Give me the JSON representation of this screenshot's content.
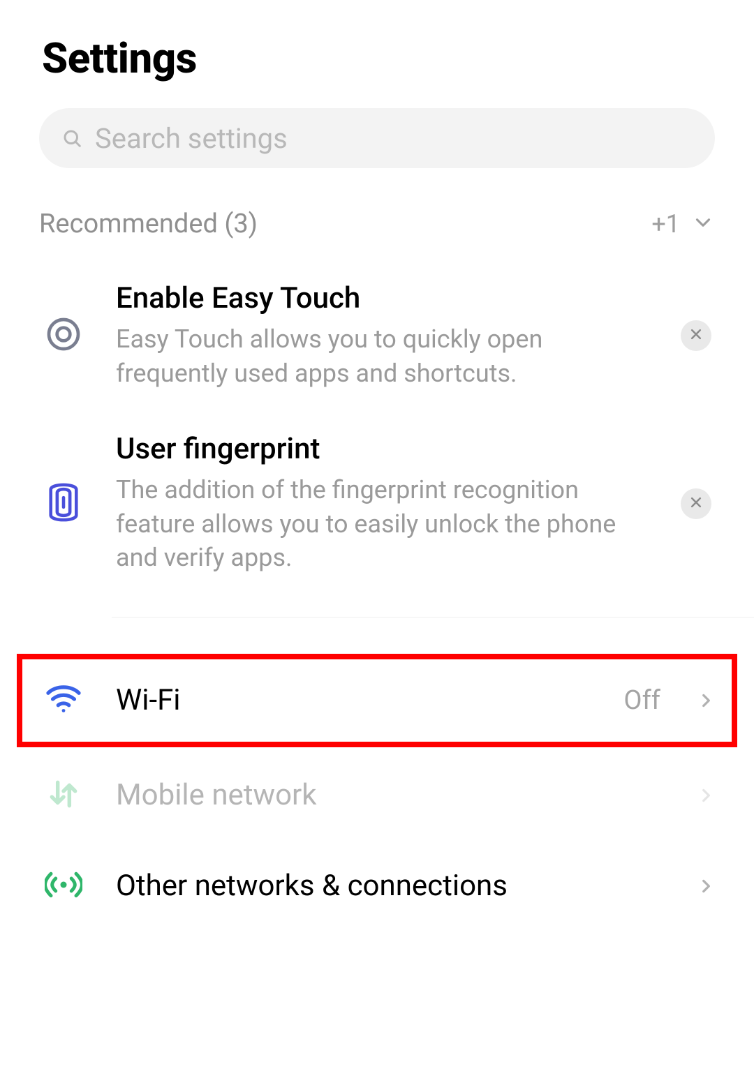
{
  "header": {
    "title": "Settings"
  },
  "search": {
    "placeholder": "Search settings"
  },
  "recommended": {
    "header_label": "Recommended (3)",
    "extra_label": "+1",
    "items": [
      {
        "title": "Enable Easy Touch",
        "desc": "Easy Touch allows you to quickly open frequently used apps and shortcuts."
      },
      {
        "title": "User fingerprint",
        "desc": "The addition of the fingerprint recognition feature allows you to easily unlock the phone and verify apps."
      }
    ]
  },
  "settings": {
    "wifi": {
      "label": "Wi-Fi",
      "value": "Off"
    },
    "mobile_network": {
      "label": "Mobile network"
    },
    "other_networks": {
      "label": "Other networks & connections"
    }
  }
}
